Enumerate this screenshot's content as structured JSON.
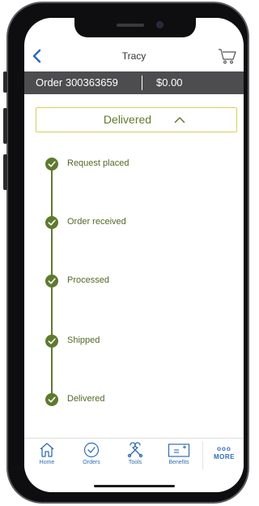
{
  "header": {
    "title": "Tracy",
    "back_icon": "chevron-left-icon",
    "cart_icon": "cart-icon"
  },
  "order": {
    "number_label": "Order 300363659",
    "total": "$0.00"
  },
  "status": {
    "label": "Delivered",
    "expanded": true
  },
  "timeline": {
    "steps": [
      {
        "label": "Request placed",
        "done": true
      },
      {
        "label": "Order received",
        "done": true
      },
      {
        "label": "Processed",
        "done": true
      },
      {
        "label": "Shipped",
        "done": true
      },
      {
        "label": "Delivered",
        "done": true
      }
    ]
  },
  "tabbar": {
    "items": [
      {
        "label": "Home",
        "icon": "home-icon"
      },
      {
        "label": "Orders",
        "icon": "orders-icon"
      },
      {
        "label": "Tools",
        "icon": "tools-icon"
      },
      {
        "label": "Benefits",
        "icon": "benefits-icon"
      }
    ],
    "more": {
      "dots": "ooo",
      "label": "MORE"
    }
  },
  "colors": {
    "accent_green": "#5f7a2e",
    "status_border": "#d8cf5a",
    "link_blue": "#2e6db4",
    "order_bar": "#4d4d4f"
  }
}
